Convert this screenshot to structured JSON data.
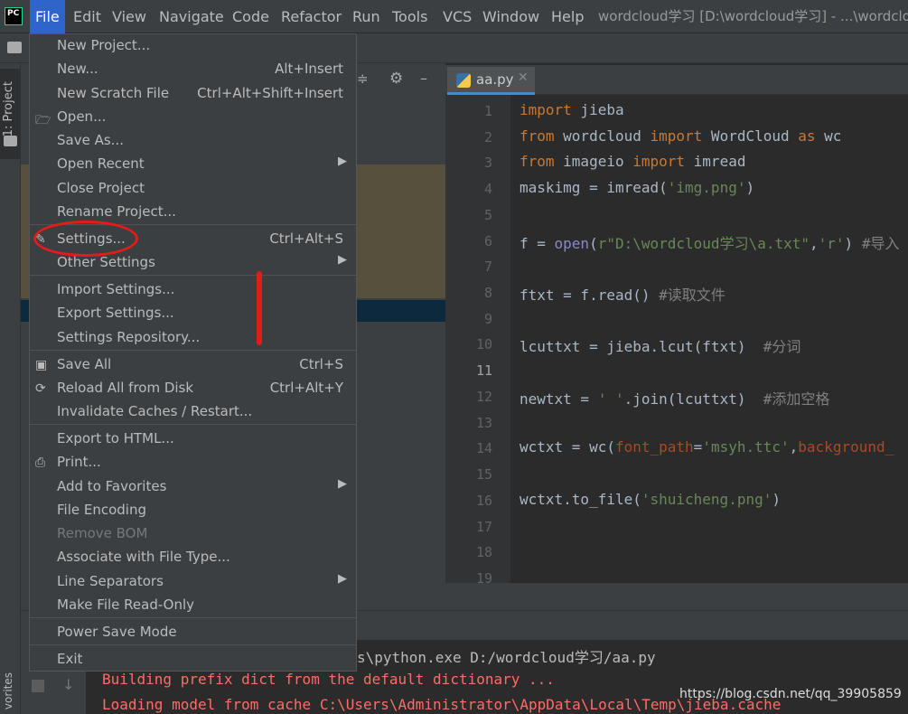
{
  "menubar": {
    "items": [
      "File",
      "Edit",
      "View",
      "Navigate",
      "Code",
      "Refactor",
      "Run",
      "Tools",
      "VCS",
      "Window",
      "Help"
    ],
    "title": "wordcloud学习 [D:\\wordcloud学习] - ...\\wordclo"
  },
  "sidebar": {
    "project_tab": "1: Project",
    "favorites_tab": "vorites"
  },
  "editor": {
    "tab_label": "aa.py",
    "line_numbers": [
      "1",
      "2",
      "3",
      "4",
      "5",
      "6",
      "7",
      "8",
      "9",
      "10",
      "11",
      "12",
      "13",
      "14",
      "15",
      "16",
      "17",
      "18",
      "19"
    ]
  },
  "file_menu": {
    "items": [
      {
        "label": "New Project...",
        "shortcut": ""
      },
      {
        "label": "New...",
        "shortcut": "Alt+Insert"
      },
      {
        "label": "New Scratch File",
        "shortcut": "Ctrl+Alt+Shift+Insert"
      },
      {
        "label": "Open...",
        "shortcut": ""
      },
      {
        "label": "Save As...",
        "shortcut": ""
      },
      {
        "label": "Open Recent",
        "shortcut": ""
      },
      {
        "label": "Close Project",
        "shortcut": ""
      },
      {
        "label": "Rename Project...",
        "shortcut": ""
      },
      {
        "label": "Settings...",
        "shortcut": "Ctrl+Alt+S"
      },
      {
        "label": "Other Settings",
        "shortcut": ""
      },
      {
        "label": "Import Settings...",
        "shortcut": ""
      },
      {
        "label": "Export Settings...",
        "shortcut": ""
      },
      {
        "label": "Settings Repository...",
        "shortcut": ""
      },
      {
        "label": "Save All",
        "shortcut": "Ctrl+S"
      },
      {
        "label": "Reload All from Disk",
        "shortcut": "Ctrl+Alt+Y"
      },
      {
        "label": "Invalidate Caches / Restart...",
        "shortcut": ""
      },
      {
        "label": "Export to HTML...",
        "shortcut": ""
      },
      {
        "label": "Print...",
        "shortcut": ""
      },
      {
        "label": "Add to Favorites",
        "shortcut": ""
      },
      {
        "label": "File Encoding",
        "shortcut": ""
      },
      {
        "label": "Remove BOM",
        "shortcut": ""
      },
      {
        "label": "Associate with File Type...",
        "shortcut": ""
      },
      {
        "label": "Line Separators",
        "shortcut": ""
      },
      {
        "label": "Make File Read-Only",
        "shortcut": ""
      },
      {
        "label": "Power Save Mode",
        "shortcut": ""
      },
      {
        "label": "Exit",
        "shortcut": ""
      }
    ]
  },
  "console": {
    "lines": [
      "s\\python.exe D:/wordcloud学习/aa.py",
      "Building prefix dict from the default dictionary ...",
      "Loading model from cache C:\\Users\\Administrator\\AppData\\Local\\Temp\\jieba.cache"
    ]
  },
  "watermark": "https://blog.csdn.net/qq_39905859"
}
